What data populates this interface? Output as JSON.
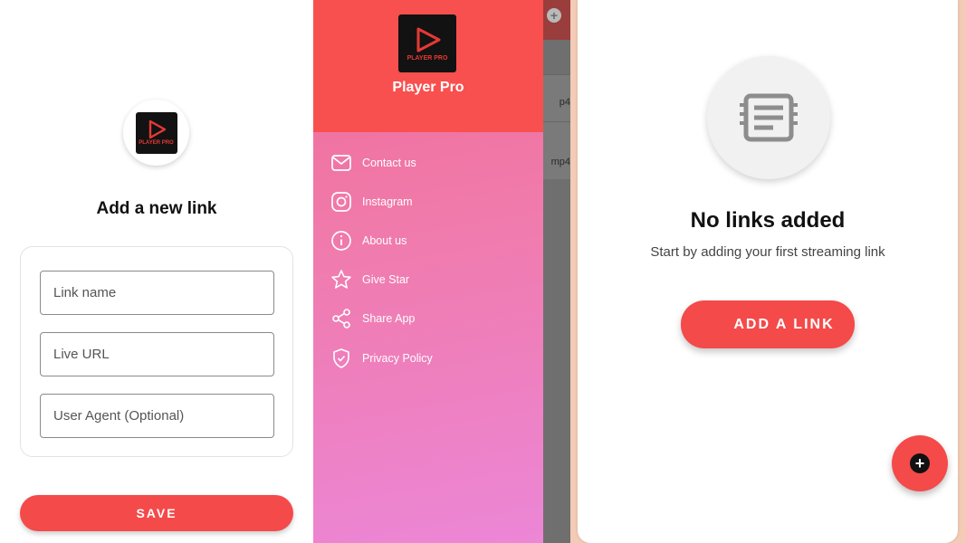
{
  "add_link_screen": {
    "logo_text": "PLAYER PRO",
    "title": "Add a new link",
    "fields": {
      "link_name_placeholder": "Link name",
      "live_url_placeholder": "Live URL",
      "user_agent_placeholder": "User Agent (Optional)"
    },
    "save_label": "SAVE"
  },
  "drawer": {
    "logo_text": "PLAYER PRO",
    "app_name": "Player Pro",
    "items": [
      {
        "label": "Contact us",
        "icon": "mail-icon"
      },
      {
        "label": "Instagram",
        "icon": "instagram-icon"
      },
      {
        "label": "About us",
        "icon": "info-icon"
      },
      {
        "label": "Give Star",
        "icon": "star-icon"
      },
      {
        "label": "Share App",
        "icon": "share-icon"
      },
      {
        "label": "Privacy Policy",
        "icon": "shield-icon"
      }
    ]
  },
  "background_list": {
    "row1_text": "p4",
    "row2_text": "mp4"
  },
  "empty_screen": {
    "title": "No links added",
    "subtitle": "Start by adding your first streaming link",
    "add_button_label": "ADD A LINK",
    "fab_icon": "plus-icon"
  },
  "colors": {
    "accent": "#f44a4a",
    "drawer_header": "#f8504f",
    "drawer_gradient_start": "#f06b98",
    "drawer_gradient_end": "#ec86d6"
  }
}
